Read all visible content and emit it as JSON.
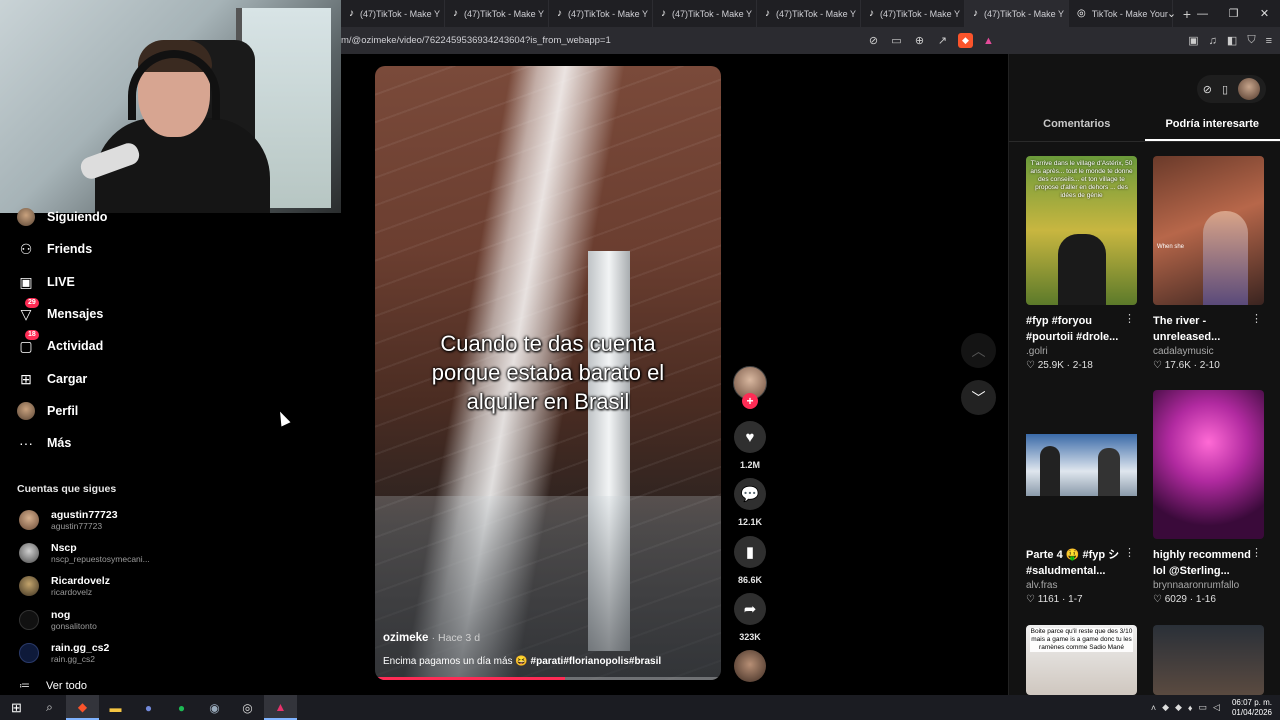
{
  "browser": {
    "tabs": [
      {
        "label": "(47)TikTok - Make Y"
      },
      {
        "label": "(47)TikTok - Make Y"
      },
      {
        "label": "(47)TikTok - Make Y"
      },
      {
        "label": "(47)TikTok - Make Y"
      },
      {
        "label": "(47)TikTok - Make Y"
      },
      {
        "label": "(47)TikTok - Make Y"
      },
      {
        "label": "(47)TikTok - Make Y"
      },
      {
        "label": "TikTok - Make Your"
      }
    ],
    "new_tab": "+",
    "url": "m/@ozimeke/video/7622459536934243604?is_from_webapp=1",
    "icons": [
      "translate-icon",
      "screen-icon",
      "zoom-icon",
      "share-icon",
      "brave-shield-icon",
      "brave-rewards-icon"
    ],
    "right_icons": [
      "sidebar-icon",
      "media-icon",
      "panel-icon",
      "wallet-icon",
      "menu-icon"
    ]
  },
  "sidebar": {
    "nav": [
      {
        "label": "Siguiendo",
        "icon": "following-avatar-icon"
      },
      {
        "label": "Friends",
        "icon": "friends-icon"
      },
      {
        "label": "LIVE",
        "icon": "live-icon"
      },
      {
        "label": "Mensajes",
        "icon": "messages-icon",
        "badge": "29"
      },
      {
        "label": "Actividad",
        "icon": "activity-icon",
        "badge": "18"
      },
      {
        "label": "Cargar",
        "icon": "upload-icon"
      },
      {
        "label": "Perfil",
        "icon": "profile-avatar-icon"
      },
      {
        "label": "Más",
        "icon": "more-icon"
      }
    ],
    "following_title": "Cuentas que sigues",
    "following": [
      {
        "name": "agustin77723",
        "handle": "agustin77723"
      },
      {
        "name": "Nscp",
        "handle": "nscp_repuestosymecani..."
      },
      {
        "name": "Ricardovelz",
        "handle": "ricardovelz"
      },
      {
        "name": "nog",
        "handle": "gonsalitonto"
      },
      {
        "name": "rain.gg_cs2",
        "handle": "rain.gg_cs2"
      }
    ],
    "see_all": "Ver todo"
  },
  "video": {
    "caption_lines": [
      "Cuando te das cuenta",
      "porque estaba barato el",
      "alquiler en Brasil"
    ],
    "author": "ozimeke",
    "posted": "· Hace 3 d",
    "description": "Encima pagamos un día más 😆 ",
    "hashtags": "#parati#florianopolis#brasil",
    "progress": 0.55
  },
  "actions": {
    "likes": "1.2M",
    "comments": "12.1K",
    "saves": "86.6K",
    "shares": "323K",
    "follow_plus": "+"
  },
  "right_panel": {
    "tabs": [
      "Comentarios",
      "Podría interesarte"
    ],
    "active_tab": "Podría interesarte",
    "cards": [
      {
        "title": "#fyp #foryou #pourtoii #drole...",
        "user": ".golri",
        "stat": "♡ 25.9K · 2-18",
        "overlay": "T'arrive dans le village d'Astérix, 50 ans après... tout le monde te donne des conseils... et ton village te propose d'aller en dehors ... des idées de génie"
      },
      {
        "title": "The river - unreleased...",
        "user": "cadalaymusic",
        "stat": "♡ 17.6K · 2-10",
        "overlay": "When she"
      },
      {
        "title": "Parte 4 🤑 #fyp シ #saludmental...",
        "user": "alv.fras",
        "stat": "♡ 1161 · 1-7",
        "overlay": ""
      },
      {
        "title": "highly recommend lol @Sterling...",
        "user": "brynnaaronrumfallo",
        "stat": "♡ 6029 · 1-16",
        "overlay": ""
      },
      {
        "title": "",
        "user": "",
        "stat": "",
        "overlay": "Boite parce qu'il reste que des 3/10 mais a game is a game donc tu les ramènes comme Sadio Mané"
      },
      {
        "title": "",
        "user": "",
        "stat": "",
        "overlay": ""
      }
    ]
  },
  "taskbar": {
    "time": "06:07 p. m.",
    "date": "01/04/2026"
  }
}
